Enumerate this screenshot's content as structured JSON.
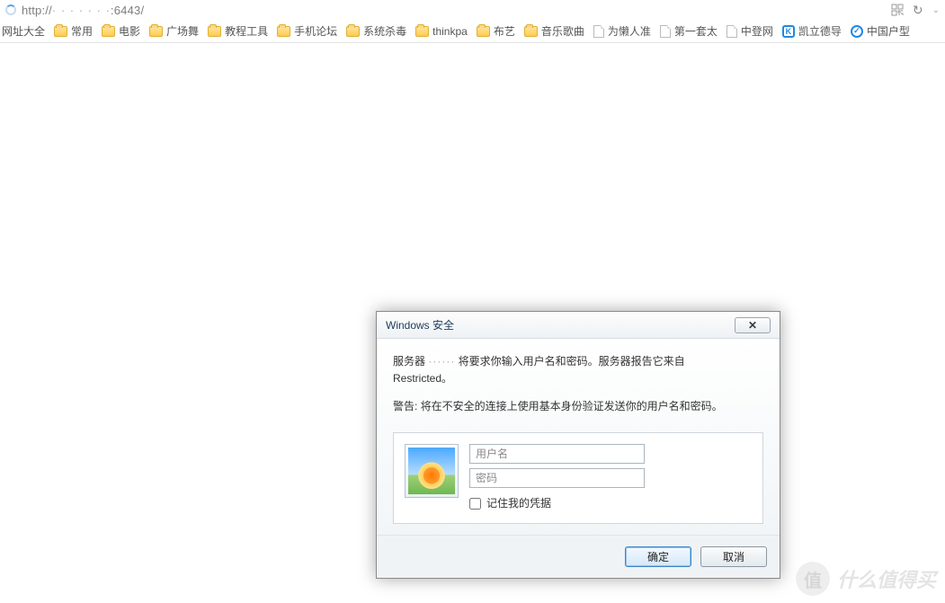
{
  "addressbar": {
    "url_prefix": "http://",
    "url_hidden": "· · · · · · ·",
    "url_suffix": ":6443/"
  },
  "bookmarks": [
    {
      "label": "网址大全",
      "icon": "none"
    },
    {
      "label": "常用",
      "icon": "folder"
    },
    {
      "label": "电影",
      "icon": "folder"
    },
    {
      "label": "广场舞",
      "icon": "folder"
    },
    {
      "label": "教程工具",
      "icon": "folder"
    },
    {
      "label": "手机论坛",
      "icon": "folder"
    },
    {
      "label": "系统杀毒",
      "icon": "folder"
    },
    {
      "label": "thinkpa",
      "icon": "folder"
    },
    {
      "label": "布艺",
      "icon": "folder"
    },
    {
      "label": "音乐歌曲",
      "icon": "folder"
    },
    {
      "label": "为懒人准",
      "icon": "page"
    },
    {
      "label": "第一套太",
      "icon": "page"
    },
    {
      "label": "中登网",
      "icon": "page"
    },
    {
      "label": "凯立德导",
      "icon": "blue-square"
    },
    {
      "label": "中国户型",
      "icon": "blue-circle"
    }
  ],
  "dialog": {
    "title": "Windows 安全",
    "message_line1_pre": "服务器 ",
    "message_line1_hidden": "······",
    "message_line1_post": " 将要求你输入用户名和密码。服务器报告它来自",
    "message_line2": "Restricted。",
    "warning": "警告: 将在不安全的连接上使用基本身份验证发送你的用户名和密码。",
    "username_placeholder": "用户名",
    "password_placeholder": "密码",
    "remember_label": "记住我的凭据",
    "ok_label": "确定",
    "cancel_label": "取消"
  },
  "watermark": {
    "badge": "值",
    "text": "什么值得买"
  }
}
